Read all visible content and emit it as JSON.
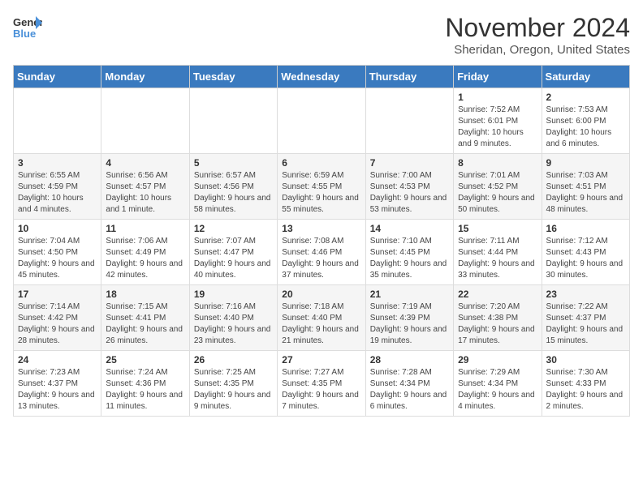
{
  "header": {
    "logo_line1": "General",
    "logo_line2": "Blue",
    "month_title": "November 2024",
    "location": "Sheridan, Oregon, United States"
  },
  "days_of_week": [
    "Sunday",
    "Monday",
    "Tuesday",
    "Wednesday",
    "Thursday",
    "Friday",
    "Saturday"
  ],
  "weeks": [
    [
      {
        "day": "",
        "info": ""
      },
      {
        "day": "",
        "info": ""
      },
      {
        "day": "",
        "info": ""
      },
      {
        "day": "",
        "info": ""
      },
      {
        "day": "",
        "info": ""
      },
      {
        "day": "1",
        "info": "Sunrise: 7:52 AM\nSunset: 6:01 PM\nDaylight: 10 hours and 9 minutes."
      },
      {
        "day": "2",
        "info": "Sunrise: 7:53 AM\nSunset: 6:00 PM\nDaylight: 10 hours and 6 minutes."
      }
    ],
    [
      {
        "day": "3",
        "info": "Sunrise: 6:55 AM\nSunset: 4:59 PM\nDaylight: 10 hours and 4 minutes."
      },
      {
        "day": "4",
        "info": "Sunrise: 6:56 AM\nSunset: 4:57 PM\nDaylight: 10 hours and 1 minute."
      },
      {
        "day": "5",
        "info": "Sunrise: 6:57 AM\nSunset: 4:56 PM\nDaylight: 9 hours and 58 minutes."
      },
      {
        "day": "6",
        "info": "Sunrise: 6:59 AM\nSunset: 4:55 PM\nDaylight: 9 hours and 55 minutes."
      },
      {
        "day": "7",
        "info": "Sunrise: 7:00 AM\nSunset: 4:53 PM\nDaylight: 9 hours and 53 minutes."
      },
      {
        "day": "8",
        "info": "Sunrise: 7:01 AM\nSunset: 4:52 PM\nDaylight: 9 hours and 50 minutes."
      },
      {
        "day": "9",
        "info": "Sunrise: 7:03 AM\nSunset: 4:51 PM\nDaylight: 9 hours and 48 minutes."
      }
    ],
    [
      {
        "day": "10",
        "info": "Sunrise: 7:04 AM\nSunset: 4:50 PM\nDaylight: 9 hours and 45 minutes."
      },
      {
        "day": "11",
        "info": "Sunrise: 7:06 AM\nSunset: 4:49 PM\nDaylight: 9 hours and 42 minutes."
      },
      {
        "day": "12",
        "info": "Sunrise: 7:07 AM\nSunset: 4:47 PM\nDaylight: 9 hours and 40 minutes."
      },
      {
        "day": "13",
        "info": "Sunrise: 7:08 AM\nSunset: 4:46 PM\nDaylight: 9 hours and 37 minutes."
      },
      {
        "day": "14",
        "info": "Sunrise: 7:10 AM\nSunset: 4:45 PM\nDaylight: 9 hours and 35 minutes."
      },
      {
        "day": "15",
        "info": "Sunrise: 7:11 AM\nSunset: 4:44 PM\nDaylight: 9 hours and 33 minutes."
      },
      {
        "day": "16",
        "info": "Sunrise: 7:12 AM\nSunset: 4:43 PM\nDaylight: 9 hours and 30 minutes."
      }
    ],
    [
      {
        "day": "17",
        "info": "Sunrise: 7:14 AM\nSunset: 4:42 PM\nDaylight: 9 hours and 28 minutes."
      },
      {
        "day": "18",
        "info": "Sunrise: 7:15 AM\nSunset: 4:41 PM\nDaylight: 9 hours and 26 minutes."
      },
      {
        "day": "19",
        "info": "Sunrise: 7:16 AM\nSunset: 4:40 PM\nDaylight: 9 hours and 23 minutes."
      },
      {
        "day": "20",
        "info": "Sunrise: 7:18 AM\nSunset: 4:40 PM\nDaylight: 9 hours and 21 minutes."
      },
      {
        "day": "21",
        "info": "Sunrise: 7:19 AM\nSunset: 4:39 PM\nDaylight: 9 hours and 19 minutes."
      },
      {
        "day": "22",
        "info": "Sunrise: 7:20 AM\nSunset: 4:38 PM\nDaylight: 9 hours and 17 minutes."
      },
      {
        "day": "23",
        "info": "Sunrise: 7:22 AM\nSunset: 4:37 PM\nDaylight: 9 hours and 15 minutes."
      }
    ],
    [
      {
        "day": "24",
        "info": "Sunrise: 7:23 AM\nSunset: 4:37 PM\nDaylight: 9 hours and 13 minutes."
      },
      {
        "day": "25",
        "info": "Sunrise: 7:24 AM\nSunset: 4:36 PM\nDaylight: 9 hours and 11 minutes."
      },
      {
        "day": "26",
        "info": "Sunrise: 7:25 AM\nSunset: 4:35 PM\nDaylight: 9 hours and 9 minutes."
      },
      {
        "day": "27",
        "info": "Sunrise: 7:27 AM\nSunset: 4:35 PM\nDaylight: 9 hours and 7 minutes."
      },
      {
        "day": "28",
        "info": "Sunrise: 7:28 AM\nSunset: 4:34 PM\nDaylight: 9 hours and 6 minutes."
      },
      {
        "day": "29",
        "info": "Sunrise: 7:29 AM\nSunset: 4:34 PM\nDaylight: 9 hours and 4 minutes."
      },
      {
        "day": "30",
        "info": "Sunrise: 7:30 AM\nSunset: 4:33 PM\nDaylight: 9 hours and 2 minutes."
      }
    ]
  ]
}
